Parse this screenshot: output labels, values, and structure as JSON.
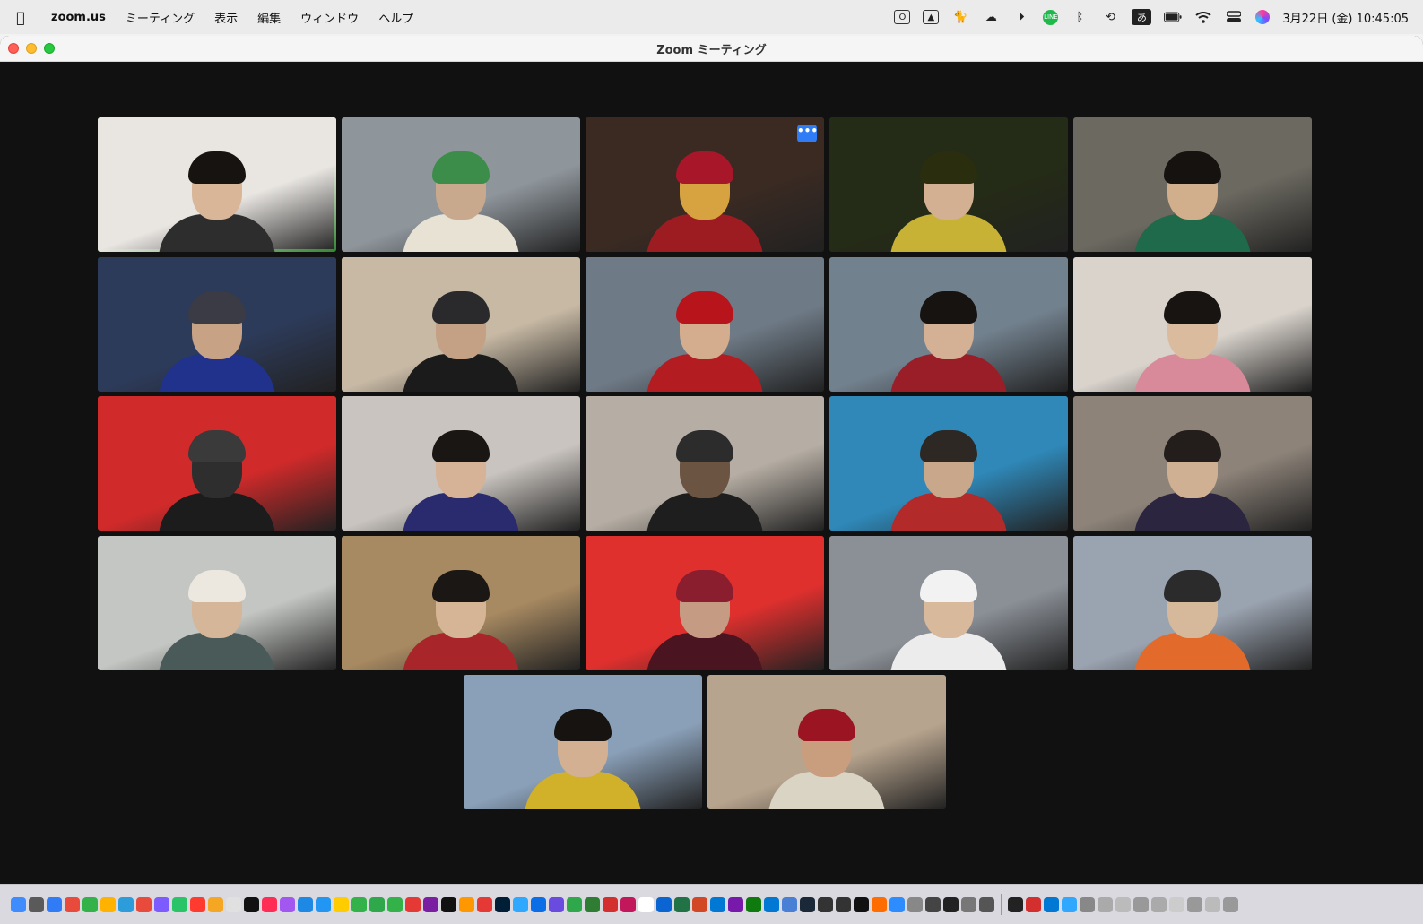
{
  "menubar": {
    "apple_icon": "apple-logo-icon",
    "items": [
      "zoom.us",
      "ミーティング",
      "表示",
      "編集",
      "ウィンドウ",
      "ヘルプ"
    ],
    "status_icons": [
      "outlook-icon",
      "drive-icon",
      "cat-icon",
      "cloud-icon",
      "play-icon",
      "line-icon",
      "bluetooth-icon",
      "time-machine-icon",
      "input-method-icon",
      "battery-icon",
      "wifi-icon",
      "control-center-icon",
      "siri-icon"
    ],
    "input_method_label": "あ",
    "line_label": "LINE",
    "clock": "3月22日 (金)  10:45:05"
  },
  "window": {
    "title": "Zoom ミーティング",
    "more_button_label": "•••"
  },
  "participants": [
    {
      "bg": "#e9e6e2",
      "head": "#d8b697",
      "hair": "#161311",
      "body": "#2d2d2d"
    },
    {
      "bg": "#8e959b",
      "head": "#c9a98e",
      "hair": "#3c8c4a",
      "body": "#e8e2d4"
    },
    {
      "bg": "#3a2a22",
      "head": "#d7a340",
      "hair": "#a8162a",
      "body": "#9c1c22"
    },
    {
      "bg": "#242b16",
      "head": "#d2b091",
      "hair": "#2a2e0e",
      "body": "#c8b236"
    },
    {
      "bg": "#6b6960",
      "head": "#d1ae8c",
      "hair": "#15120f",
      "body": "#1f6a4a"
    },
    {
      "bg": "#2d3b5a",
      "head": "#c8a285",
      "hair": "#3a3b44",
      "body": "#20328c"
    },
    {
      "bg": "#c7b9a4",
      "head": "#c4a084",
      "hair": "#2a2a2c",
      "body": "#1b1b1b"
    },
    {
      "bg": "#6e7a86",
      "head": "#d3ad8d",
      "hair": "#b8141c",
      "body": "#b31d22"
    },
    {
      "bg": "#72818e",
      "head": "#d4b094",
      "hair": "#171311",
      "body": "#9a1e28"
    },
    {
      "bg": "#d9d3cc",
      "head": "#dbbb9e",
      "hair": "#181412",
      "body": "#d88a9a"
    },
    {
      "bg": "#d12a2a",
      "head": "#2e2e2e",
      "hair": "#3a3a3a",
      "body": "#1c1c1c"
    },
    {
      "bg": "#c9c4bf",
      "head": "#d6b396",
      "hair": "#1a1614",
      "body": "#2a2a6e"
    },
    {
      "bg": "#b6aea4",
      "head": "#6b5442",
      "hair": "#2c2c2c",
      "body": "#1e1e1e"
    },
    {
      "bg": "#2f88b8",
      "head": "#c9a78a",
      "hair": "#2e2824",
      "body": "#b22a2a"
    },
    {
      "bg": "#8d8379",
      "head": "#d0b093",
      "hair": "#231e1b",
      "body": "#2b2540"
    },
    {
      "bg": "#c3c6c2",
      "head": "#d5b699",
      "hair": "#ece8df",
      "body": "#4a5a58"
    },
    {
      "bg": "#a88a62",
      "head": "#d6b496",
      "hair": "#1b1715",
      "body": "#a8262a"
    },
    {
      "bg": "#e0302e",
      "head": "#c59b83",
      "hair": "#8a1d2e",
      "body": "#4a1420"
    },
    {
      "bg": "#8b9097",
      "head": "#d8b99c",
      "hair": "#f2f2f2",
      "body": "#ececec"
    },
    {
      "bg": "#9aa3b0",
      "head": "#d6b89a",
      "hair": "#2b2b2b",
      "body": "#e26a2a"
    },
    {
      "bg": "#8aa0b8",
      "head": "#d3b092",
      "hair": "#161311",
      "body": "#d1b02a"
    },
    {
      "bg": "#b7a48e",
      "head": "#c99e7f",
      "hair": "#9b1422",
      "body": "#d9d4c4"
    }
  ],
  "dock": {
    "icon_colors": [
      "#3f8cff",
      "#5a5a5a",
      "#2f7cf6",
      "#e84b3c",
      "#33b249",
      "#ffb300",
      "#2d9cdb",
      "#e84b3c",
      "#7c5cff",
      "#29c468",
      "#ff3b30",
      "#f5a623",
      "#e0e0e0",
      "#111111",
      "#ff2d55",
      "#a257f0",
      "#1e88e5",
      "#2196f3",
      "#ffcc00",
      "#33b249",
      "#2ea84a",
      "#33b249",
      "#e53935",
      "#7b1fa2",
      "#111",
      "#ff9800",
      "#e53935",
      "#001e36",
      "#31a8ff",
      "#0b6ee6",
      "#6a4be0",
      "#2ea84a",
      "#2e7d32",
      "#d32f2f",
      "#c2185b",
      "#ffffff",
      "#0a64d2",
      "#217346",
      "#d24726",
      "#0078d4",
      "#7719aa",
      "#0f7b0f",
      "#0078d4",
      "#4a7fd6",
      "#1b2838",
      "#333",
      "#333",
      "#111",
      "#ff6d00",
      "#2d8cff",
      "#888",
      "#444",
      "#222",
      "#777",
      "#555",
      "#222",
      "#d32f2f",
      "#0078d4",
      "#31a8ff",
      "#888",
      "#aaa",
      "#bbb",
      "#999",
      "#aaa",
      "#ccc",
      "#999",
      "#bbb",
      "#999"
    ]
  }
}
